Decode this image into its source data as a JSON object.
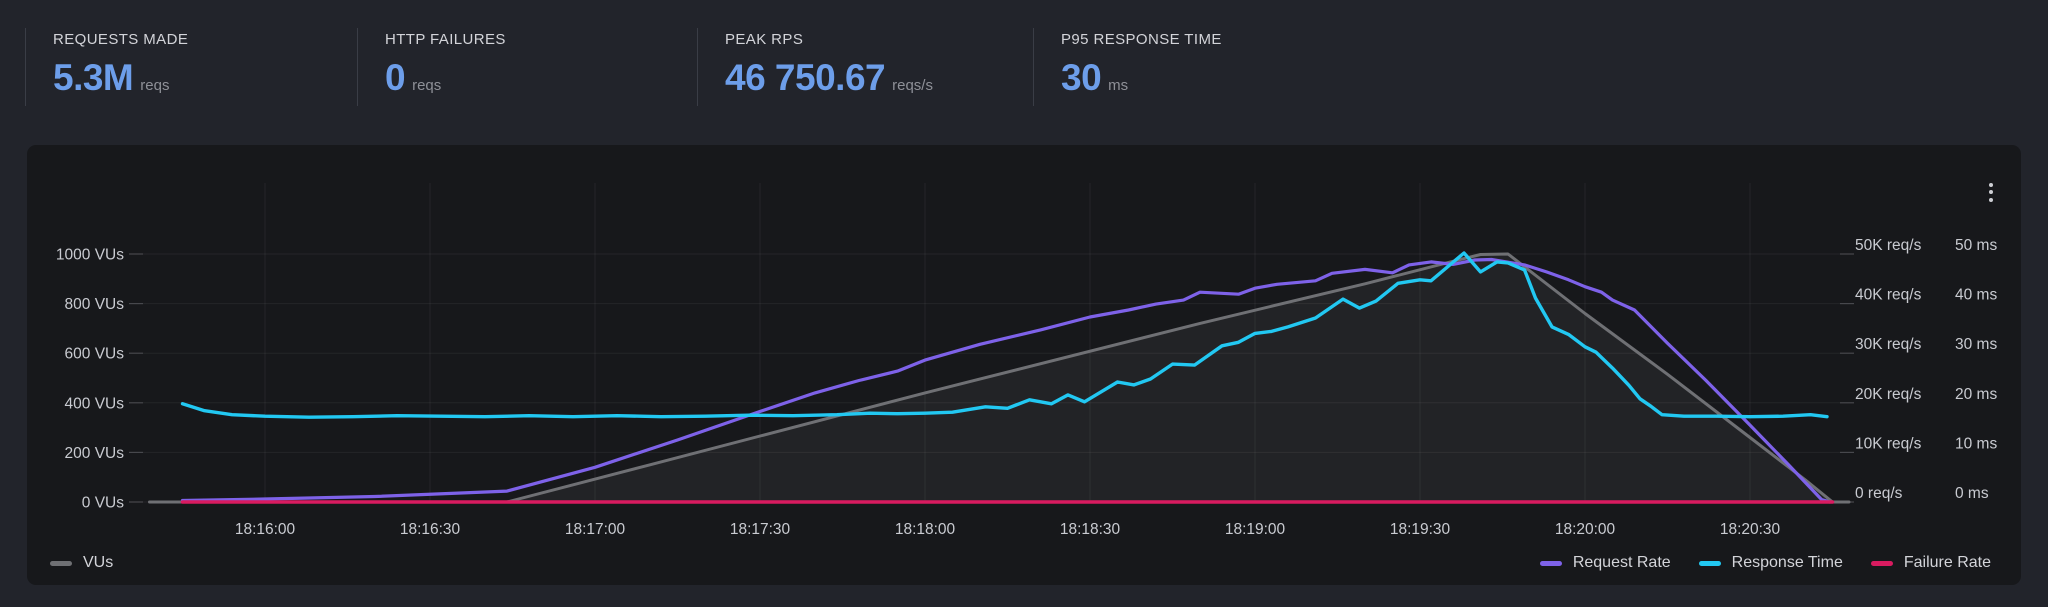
{
  "stats": [
    {
      "label": "REQUESTS MADE",
      "value": "5.3M",
      "unit": "reqs"
    },
    {
      "label": "HTTP FAILURES",
      "value": "0",
      "unit": "reqs"
    },
    {
      "label": "PEAK RPS",
      "value": "46 750.67",
      "unit": "reqs/s"
    },
    {
      "label": "P95 RESPONSE TIME",
      "value": "30",
      "unit": "ms"
    }
  ],
  "colors": {
    "page_bg": "#22242b",
    "panel_bg": "#17181b",
    "stat_value": "#6d9eea",
    "axis_text": "#c9cbd1",
    "gridline": "rgba(255,255,255,0.06)",
    "tick_dash": "#47484d",
    "vus_line": "#6f7074",
    "vus_fill": "rgba(255,255,255,0.05)",
    "request_rate": "#7e62e9",
    "response_time": "#22c8f2",
    "failure_rate": "#d91b60"
  },
  "panel_menu_icon": "kebab-vertical",
  "chart_data": {
    "type": "line",
    "x_axis": {
      "tick_labels": [
        "18:16:00",
        "18:16:30",
        "18:17:00",
        "18:17:30",
        "18:18:00",
        "18:18:30",
        "18:19:00",
        "18:19:30",
        "18:20:00",
        "18:20:30"
      ],
      "tick_interval_seconds": 30
    },
    "y_axis_left_vus": {
      "labels": [
        "0 VUs",
        "200 VUs",
        "400 VUs",
        "600 VUs",
        "800 VUs",
        "1000 VUs"
      ],
      "min": 0,
      "max": 1000
    },
    "y_axis_right_rps": {
      "labels": [
        "0 req/s",
        "10K req/s",
        "20K req/s",
        "30K req/s",
        "40K req/s",
        "50K req/s"
      ],
      "min": 0,
      "max": 50000
    },
    "y_axis_right_ms": {
      "labels": [
        "0 ms",
        "10 ms",
        "20 ms",
        "30 ms",
        "40 ms",
        "50 ms"
      ],
      "min": 0,
      "max": 50
    },
    "axis_max": {
      "vus": 1000,
      "rps_k": 50,
      "ms": 50
    },
    "grid": true,
    "legend_position": "bottom",
    "series": [
      {
        "name": "VUs",
        "axis": "vus",
        "color": "#6f7074",
        "fill": "rgba(255,255,255,0.05)",
        "width": 3,
        "points": [
          [
            -21,
            0
          ],
          [
            44,
            0
          ],
          [
            70,
            150
          ],
          [
            120,
            440
          ],
          [
            170,
            720
          ],
          [
            200,
            880
          ],
          [
            215,
            965
          ],
          [
            221,
            998
          ],
          [
            226,
            1000
          ],
          [
            240,
            760
          ],
          [
            255,
            515
          ],
          [
            270,
            260
          ],
          [
            280,
            90
          ],
          [
            285,
            0
          ],
          [
            288,
            0
          ]
        ]
      },
      {
        "name": "Request Rate",
        "axis": "rps_k",
        "color": "#7e62e9",
        "width": 3.2,
        "points": [
          [
            -15,
            0.3
          ],
          [
            0,
            0.6
          ],
          [
            20,
            1.1
          ],
          [
            44,
            2.2
          ],
          [
            60,
            7
          ],
          [
            75,
            12.5
          ],
          [
            88,
            17.5
          ],
          [
            100,
            22
          ],
          [
            108,
            24.5
          ],
          [
            115,
            26.4
          ],
          [
            120,
            28.6
          ],
          [
            130,
            31.8
          ],
          [
            141,
            34.7
          ],
          [
            150,
            37.3
          ],
          [
            157,
            38.7
          ],
          [
            162,
            39.9
          ],
          [
            167,
            40.7
          ],
          [
            170,
            42.3
          ],
          [
            177,
            41.9
          ],
          [
            180,
            43.1
          ],
          [
            184,
            43.9
          ],
          [
            191,
            44.6
          ],
          [
            194,
            46.1
          ],
          [
            200,
            46.9
          ],
          [
            205,
            46.2
          ],
          [
            208,
            47.8
          ],
          [
            212,
            48.4
          ],
          [
            216,
            47.9
          ],
          [
            220,
            48.8
          ],
          [
            223,
            48.9
          ],
          [
            229,
            47.8
          ],
          [
            233,
            46.4
          ],
          [
            237,
            44.8
          ],
          [
            240,
            43.4
          ],
          [
            243,
            42.3
          ],
          [
            245,
            40.7
          ],
          [
            249,
            38.7
          ],
          [
            255,
            32
          ],
          [
            262,
            24.5
          ],
          [
            270,
            15.5
          ],
          [
            277,
            7.5
          ],
          [
            283,
            0.5
          ],
          [
            284.5,
            0
          ]
        ]
      },
      {
        "name": "Response Time",
        "axis": "ms",
        "color": "#22c8f2",
        "width": 3.4,
        "points": [
          [
            -15,
            19.8
          ],
          [
            -11,
            18.4
          ],
          [
            -6,
            17.6
          ],
          [
            0,
            17.3
          ],
          [
            8,
            17.1
          ],
          [
            16,
            17.2
          ],
          [
            24,
            17.4
          ],
          [
            32,
            17.3
          ],
          [
            40,
            17.2
          ],
          [
            48,
            17.4
          ],
          [
            56,
            17.2
          ],
          [
            64,
            17.4
          ],
          [
            72,
            17.2
          ],
          [
            80,
            17.3
          ],
          [
            88,
            17.5
          ],
          [
            96,
            17.4
          ],
          [
            104,
            17.6
          ],
          [
            110,
            17.9
          ],
          [
            115,
            17.8
          ],
          [
            120,
            17.9
          ],
          [
            125,
            18.1
          ],
          [
            131,
            19.2
          ],
          [
            135,
            18.9
          ],
          [
            139,
            20.6
          ],
          [
            143,
            19.8
          ],
          [
            146,
            21.6
          ],
          [
            149,
            20.2
          ],
          [
            155,
            24.2
          ],
          [
            158,
            23.6
          ],
          [
            161,
            24.8
          ],
          [
            165,
            27.8
          ],
          [
            169,
            27.6
          ],
          [
            174,
            31.5
          ],
          [
            177,
            32.2
          ],
          [
            180,
            34
          ],
          [
            183,
            34.4
          ],
          [
            186,
            35.3
          ],
          [
            191,
            37.1
          ],
          [
            196,
            40.9
          ],
          [
            199,
            39.1
          ],
          [
            202,
            40.5
          ],
          [
            206,
            44.1
          ],
          [
            210,
            44.8
          ],
          [
            212,
            44.6
          ],
          [
            218,
            50.2
          ],
          [
            221,
            46.4
          ],
          [
            224,
            48.4
          ],
          [
            226,
            48.2
          ],
          [
            229,
            46.8
          ],
          [
            231,
            41.1
          ],
          [
            234,
            35.3
          ],
          [
            237,
            33.8
          ],
          [
            240,
            31.3
          ],
          [
            242,
            30.2
          ],
          [
            245,
            27
          ],
          [
            248,
            23.5
          ],
          [
            250,
            20.8
          ],
          [
            252,
            19.3
          ],
          [
            254,
            17.6
          ],
          [
            258,
            17.3
          ],
          [
            264,
            17.3
          ],
          [
            270,
            17.2
          ],
          [
            276,
            17.3
          ],
          [
            281,
            17.6
          ],
          [
            284,
            17.2
          ]
        ]
      },
      {
        "name": "Failure Rate",
        "axis": "rps_k",
        "color": "#d91b60",
        "width": 3.6,
        "points": [
          [
            -15,
            0
          ],
          [
            50,
            0
          ],
          [
            120,
            0
          ],
          [
            200,
            0
          ],
          [
            285,
            0
          ]
        ]
      }
    ],
    "legend_left": [
      {
        "name": "VUs",
        "color": "#6f7074"
      }
    ],
    "legend_right": [
      {
        "name": "Request Rate",
        "color": "#7e62e9"
      },
      {
        "name": "Response Time",
        "color": "#22c8f2"
      },
      {
        "name": "Failure Rate",
        "color": "#d91b60"
      }
    ]
  }
}
